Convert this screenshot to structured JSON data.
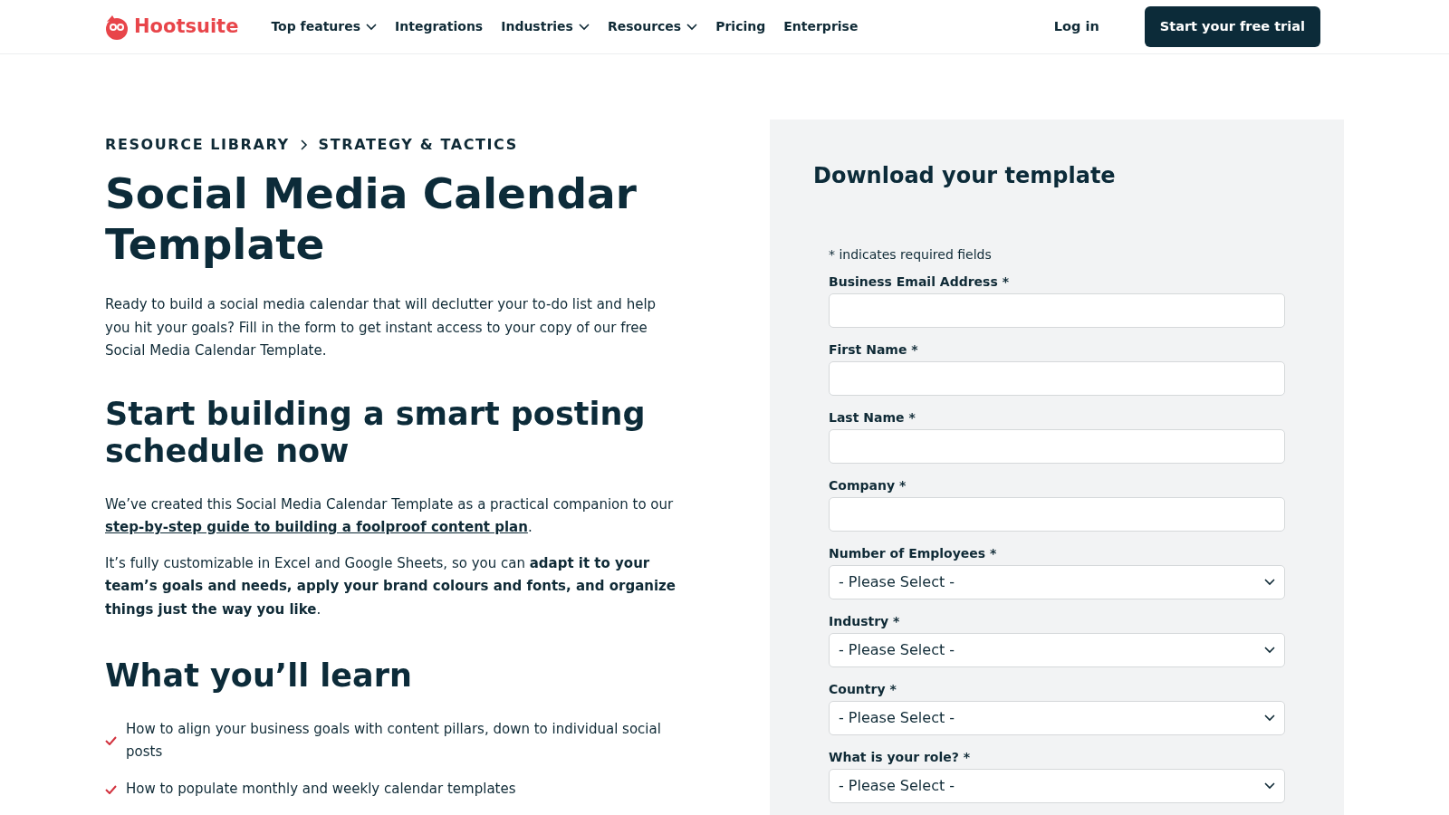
{
  "nav": {
    "logo": "Hootsuite",
    "items": [
      {
        "label": "Top features",
        "dropdown": true
      },
      {
        "label": "Integrations",
        "dropdown": false
      },
      {
        "label": "Industries",
        "dropdown": true
      },
      {
        "label": "Resources",
        "dropdown": true
      },
      {
        "label": "Pricing",
        "dropdown": false
      },
      {
        "label": "Enterprise",
        "dropdown": false
      }
    ],
    "login": "Log in",
    "cta": "Start your free trial"
  },
  "breadcrumb": [
    "RESOURCE LIBRARY",
    "STRATEGY & TACTICS"
  ],
  "title": "Social Media Calendar Template",
  "intro": "Ready to build a social media calendar that will declutter your to-do list and help you hit your goals? Fill in the form to get instant access to your copy of our free Social Media Calendar Template.",
  "section_heading": "Start building a smart posting schedule now",
  "paragraphs": [
    {
      "parts": [
        {
          "kind": "text",
          "text": "We’ve created this Social Media Calendar Template as a practical companion to our "
        },
        {
          "kind": "link",
          "text": "step-by-step guide to building a foolproof content plan"
        },
        {
          "kind": "text",
          "text": "."
        }
      ]
    },
    {
      "parts": [
        {
          "kind": "text",
          "text": "It’s fully customizable in Excel and Google Sheets, so you can **adapt it to your team’s goals and needs, apply your brand colours and fonts, and organize things just the way you like**."
        }
      ]
    }
  ],
  "learn_heading": "What you’ll learn",
  "learn_items": [
    "How to align your business goals with content pillars, down to individual social posts",
    "How to populate monthly and weekly calendar templates"
  ],
  "form": {
    "title": "Download your template",
    "required_note": "* indicates required fields",
    "fields": [
      {
        "label": "Business Email Address *",
        "kind": "text"
      },
      {
        "label": "First Name *",
        "kind": "text"
      },
      {
        "label": "Last Name *",
        "kind": "text"
      },
      {
        "label": "Company *",
        "kind": "text"
      },
      {
        "label": "Number of Employees *",
        "kind": "select",
        "value": "- Please Select -"
      },
      {
        "label": "Industry *",
        "kind": "select",
        "value": "- Please Select -"
      },
      {
        "label": "Country *",
        "kind": "select",
        "value": "- Please Select -"
      },
      {
        "label": "What is your role? *",
        "kind": "select",
        "value": "- Please Select -"
      }
    ]
  }
}
